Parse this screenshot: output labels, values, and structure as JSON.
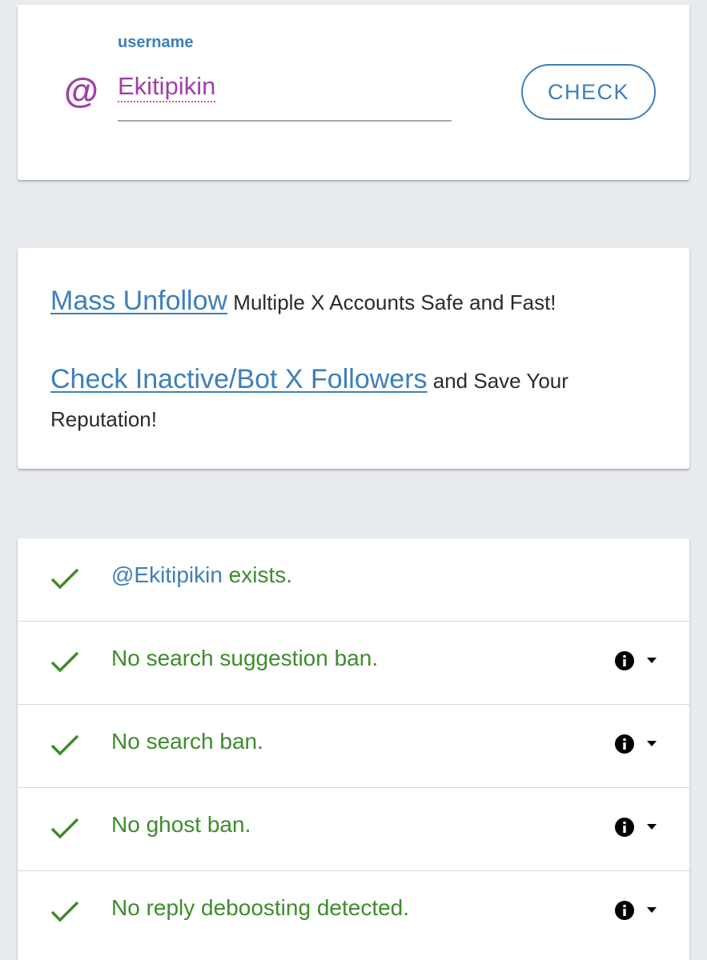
{
  "search": {
    "label": "username",
    "prefix_icon": "at-icon",
    "value": "Ekitipikin",
    "check_label": "CHECK"
  },
  "promo": {
    "line1": {
      "link": "Mass Unfollow",
      "text": " Multiple X Accounts Safe and Fast!"
    },
    "line2": {
      "link": "Check Inactive/Bot X Followers",
      "text": " and Save Your Reputation!"
    }
  },
  "results": [
    {
      "handle": "@Ekitipikin",
      "text": " exists.",
      "has_info": false
    },
    {
      "text": "No search suggestion ban.",
      "has_info": true
    },
    {
      "text": "No search ban.",
      "has_info": true
    },
    {
      "text": "No ghost ban.",
      "has_info": true
    },
    {
      "text": "No reply deboosting detected.",
      "has_info": true
    }
  ],
  "colors": {
    "accent_blue": "#3d7fba",
    "accent_purple": "#a03fa8",
    "success_green": "#3e8c2b",
    "background": "#e8ebee"
  }
}
